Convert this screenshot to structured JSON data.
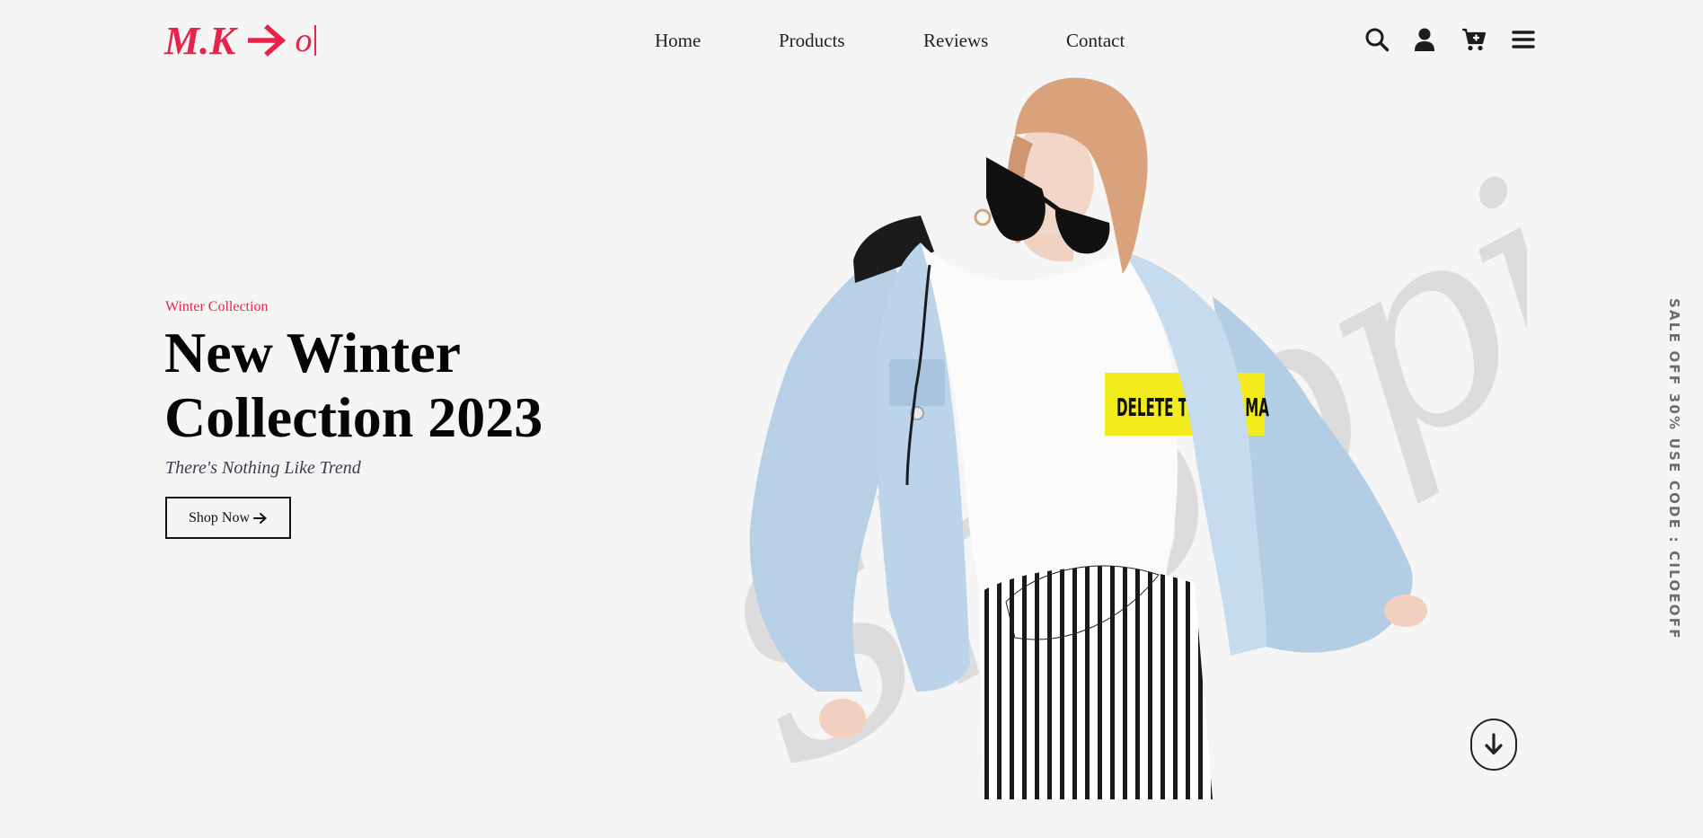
{
  "brand": {
    "logo_text": "M.K",
    "logo_tail": "o",
    "accent_color": "#e8234a"
  },
  "nav": {
    "items": [
      "Home",
      "Products",
      "Reviews",
      "Contact"
    ]
  },
  "header_icons": [
    "search-icon",
    "user-icon",
    "cart-plus-icon",
    "menu-icon"
  ],
  "hero": {
    "kicker": "Winter Collection",
    "title_line1": "New Winter",
    "title_line2": "Collection 2023",
    "tagline": "There's Nothing Like Trend",
    "cta_label": "Shop Now",
    "cta_icon": "arrow-right-icon",
    "background_script": "Shopping",
    "tshirt_text": "DELETE THE DRAMA",
    "scroll_icon": "arrow-down-icon"
  },
  "promo": {
    "side_text": "SALE OFF 30% USE CODE : CILOEOFF"
  }
}
